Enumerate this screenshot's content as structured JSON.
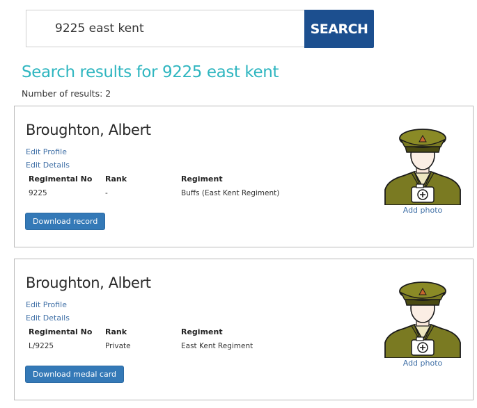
{
  "search": {
    "value": "9225 east kent",
    "button_label": "SEARCH"
  },
  "results": {
    "title": "Search results for 9225 east kent",
    "count_text": "Number of results: 2",
    "headers": {
      "regimental_no": "Regimental No",
      "rank": "Rank",
      "regiment": "Regiment"
    },
    "items": [
      {
        "name": "Broughton, Albert",
        "edit_profile": "Edit Profile",
        "edit_details": "Edit Details",
        "regimental_no": "9225",
        "rank": "-",
        "regiment": "Buffs (East Kent Regiment)",
        "download_label": "Download record",
        "add_photo": "Add photo"
      },
      {
        "name": "Broughton, Albert",
        "edit_profile": "Edit Profile",
        "edit_details": "Edit Details",
        "regimental_no": "L/9225",
        "rank": "Private",
        "regiment": "East Kent Regiment",
        "download_label": "Download medal card",
        "add_photo": "Add photo"
      }
    ]
  },
  "colors": {
    "accent_title": "#2fb6c0",
    "search_button": "#1c4f8f",
    "download_button": "#3479b7",
    "link": "#3f6fa6",
    "uniform": "#7a7a22"
  },
  "icons": {
    "avatar": "soldier-placeholder-icon"
  }
}
